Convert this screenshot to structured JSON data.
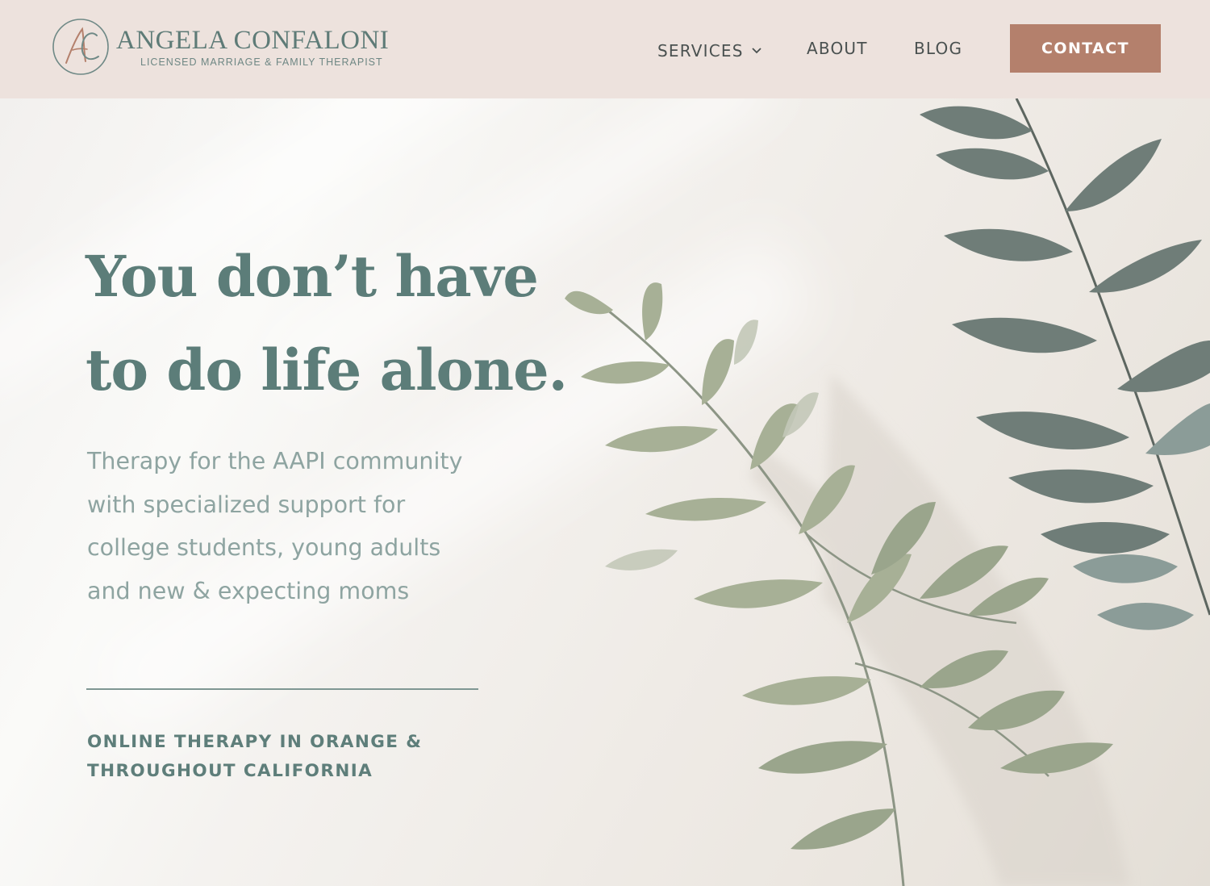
{
  "brand": {
    "monogram": "AC",
    "name": "ANGELA CONFALONI",
    "tagline": "LICENSED MARRIAGE & FAMILY THERAPIST"
  },
  "nav": {
    "services": "SERVICES",
    "about": "ABOUT",
    "blog": "BLOG",
    "contact": "CONTACT"
  },
  "hero": {
    "headline_line1": "You don’t have",
    "headline_line2": "to do life alone.",
    "subtext": "Therapy for the AAPI community with specialized support for college students, young adults and new & expecting moms",
    "location_line1": "ONLINE THERAPY IN ORANGE &",
    "location_line2": "THROUGHOUT CALIFORNIA"
  },
  "colors": {
    "header_bg": "#ede2dd",
    "accent": "#b4806c",
    "teal": "#5c7d79",
    "muted_teal": "#8ea4a1"
  },
  "icons": {
    "services_dropdown": "chevron-down-icon",
    "logo_mark": "monogram-icon",
    "hero_image": "olive-leaves-image"
  }
}
